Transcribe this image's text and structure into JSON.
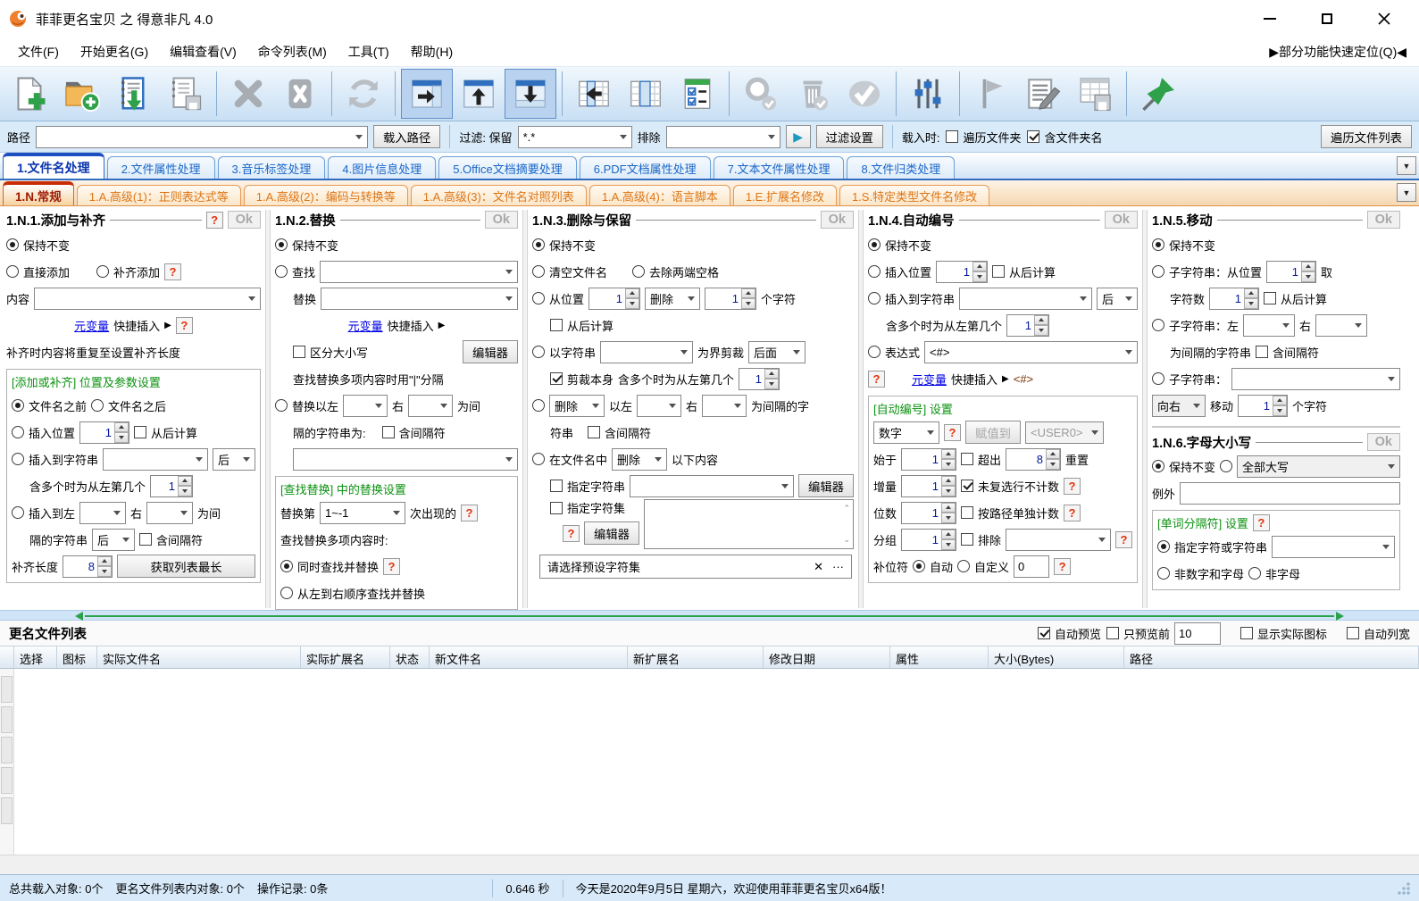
{
  "window": {
    "title": "菲菲更名宝贝 之 得意非凡 4.0"
  },
  "menu": {
    "items": [
      "文件(F)",
      "开始更名(G)",
      "编辑查看(V)",
      "命令列表(M)",
      "工具(T)",
      "帮助(H)"
    ],
    "quick_locate": "▶部分功能快速定位(Q)◀"
  },
  "toolbar": {
    "buttons": [
      "add-files",
      "add-folder",
      "import-list",
      "save-list",
      "remove-selected",
      "clear-list",
      "refresh",
      "show-right-panel",
      "show-top-panel",
      "show-bottom-panel",
      "move-column-left",
      "column-layout",
      "check-options",
      "search",
      "delete",
      "apply",
      "filter-sliders",
      "flag",
      "edit-list",
      "export-table",
      "pin"
    ]
  },
  "path_bar": {
    "path_label": "路径",
    "load_path": "载入路径",
    "filter_label": "过滤: 保留",
    "filter_value": "*.*",
    "exclude_label": "排除",
    "filter_settings": "过滤设置",
    "load_when": "载入时:",
    "traverse_folders": "遍历文件夹",
    "include_folder_name": "含文件夹名",
    "traverse_list": "遍历文件列表"
  },
  "tabs_main": [
    "1.文件名处理",
    "2.文件属性处理",
    "3.音乐标签处理",
    "4.图片信息处理",
    "5.Office文档摘要处理",
    "6.PDF文档属性处理",
    "7.文本文件属性处理",
    "8.文件归类处理"
  ],
  "tabs_sub": [
    "1.N.常规",
    "1.A.高级(1)：正则表达式等",
    "1.A.高级(2)：编码与转换等",
    "1.A.高级(3)：文件名对照列表",
    "1.A.高级(4)：语言脚本",
    "1.E.扩展名修改",
    "1.S.特定类型文件名修改"
  ],
  "common": {
    "ok": "Ok",
    "help": "?",
    "keep": "保持不变",
    "from_end": "从后计算",
    "incl_sep": "含间隔符",
    "editor": "编辑器",
    "var_link": "元变量",
    "var_insert": "快捷插入",
    "arrow": "▶",
    "right": "右",
    "after": "后",
    "delete": "删除",
    "multi_nth": "含多个时为从左第几个",
    "dropdown": "▼",
    "play": "▶",
    "ellipsis": "···",
    "clear": "✕"
  },
  "p1": {
    "title": "1.N.1.添加与补齐",
    "direct_add": "直接添加",
    "pad_add": "补齐添加",
    "content_label": "内容",
    "pad_note": "补齐时内容将重复至设置补齐长度",
    "group_title": "[添加或补齐] 位置及参数设置",
    "before": "文件名之前",
    "after_name": "文件名之后",
    "insert_pos": "插入位置",
    "pos_value": "1",
    "insert_to_str": "插入到字符串",
    "multi_value": "1",
    "insert_left": "插入到左",
    "as_sep": "为间",
    "sep_str": "隔的字符串",
    "pad_len_label": "补齐长度",
    "pad_len": "8",
    "get_longest": "获取列表最长"
  },
  "p2": {
    "title": "1.N.2.替换",
    "find": "查找",
    "replace": "替换",
    "case_sensitive": "区分大小写",
    "multi_note": "查找替换多项内容时用\"|\"分隔",
    "replace_between": "替换以左",
    "as_sep": "为间",
    "sep_line": "隔的字符串为:",
    "group_title": "[查找替换] 中的替换设置",
    "nth_label": "替换第",
    "nth_value": "1~-1",
    "nth_suffix": "次出现的",
    "multi_mode": "查找替换多项内容时:",
    "mode_simul": "同时查找并替换",
    "mode_ltr": "从左到右顺序查找并替换"
  },
  "p3": {
    "title": "1.N.3.删除与保留",
    "clear_name": "清空文件名",
    "trim": "去除两端空格",
    "from_pos": "从位置",
    "pos": "1",
    "count": "1",
    "chars": "个字符",
    "by_string": "以字符串",
    "cut_label": "为界剪裁",
    "cut_side": "后面",
    "cut_self": "剪裁本身",
    "multi": "1",
    "between_l": "以左",
    "as_sep": "为间隔的字",
    "strline": "符串",
    "in_name": "在文件名中",
    "following": "以下内容",
    "spec_str": "指定字符串",
    "spec_set": "指定字符集",
    "preset": "请选择预设字符集"
  },
  "p4": {
    "title": "1.N.4.自动编号",
    "insert_pos": "插入位置",
    "pos": "1",
    "insert_to_str": "插入到字符串",
    "multi": "1",
    "expr_label": "表达式",
    "expr": "<#>",
    "expr_preview": "<#>",
    "group_title": "[自动编号] 设置",
    "type": "数字",
    "assign": "赋值到",
    "assign_target": "<USER0>",
    "start_label": "始于",
    "start": "1",
    "over_label": "超出",
    "over": "8",
    "reset": "重置",
    "incr_label": "增量",
    "incr": "1",
    "uncounted": "未复选行不计数",
    "digits_label": "位数",
    "digits": "1",
    "per_path": "按路径单独计数",
    "group_label": "分组",
    "group": "1",
    "exclude": "排除",
    "pad_label": "补位符",
    "auto": "自动",
    "custom": "自定义",
    "custom_value": "0"
  },
  "p5": {
    "title": "1.N.5.移动",
    "sub1": "子字符串：从位置",
    "pos": "1",
    "take": "取",
    "count_label": "字符数",
    "count": "1",
    "sub2": "子字符串：左",
    "sep_note": "为间隔的字符串",
    "sub3": "子字符串：",
    "dir": "向右",
    "move": "移动",
    "move_count": "1",
    "chars": "个字符"
  },
  "p6": {
    "title": "1.N.6.字母大小写",
    "case_option": "全部大写",
    "except": "例外",
    "group_title": "[单词分隔符] 设置",
    "spec": "指定字符或字符串",
    "non_alnum": "非数字和字母",
    "non_alpha": "非字母"
  },
  "list_bar": {
    "title": "更名文件列表",
    "auto_preview": "自动预览",
    "preview_first": "只预览前",
    "preview_count": "10",
    "show_icons": "显示实际图标",
    "auto_width": "自动列宽"
  },
  "table": {
    "headers": [
      "选择",
      "图标",
      "实际文件名",
      "实际扩展名",
      "状态",
      "新文件名",
      "新扩展名",
      "修改日期",
      "属性",
      "大小(Bytes)",
      "路径"
    ]
  },
  "status": {
    "loaded": "总共载入对象: 0个",
    "in_list": "更名文件列表内对象: 0个",
    "ops": "操作记录: 0条",
    "time": "0.646 秒",
    "message": "今天是2020年9月5日 星期六，欢迎使用菲菲更名宝贝x64版！"
  }
}
